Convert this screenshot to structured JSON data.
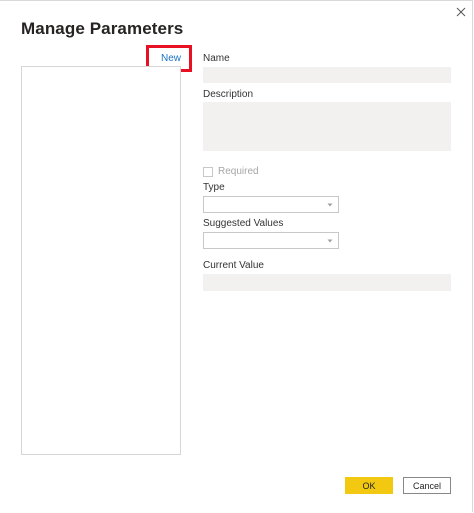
{
  "dialog": {
    "title": "Manage Parameters"
  },
  "list": {
    "new_label": "New"
  },
  "form": {
    "name_label": "Name",
    "name_value": "",
    "description_label": "Description",
    "description_value": "",
    "required_label": "Required",
    "required_checked": false,
    "type_label": "Type",
    "type_value": "",
    "suggested_values_label": "Suggested Values",
    "suggested_values_value": "",
    "current_value_label": "Current Value",
    "current_value_value": ""
  },
  "footer": {
    "ok_label": "OK",
    "cancel_label": "Cancel"
  },
  "colors": {
    "highlight_box": "#e81123",
    "link": "#1a73c6",
    "ok_button": "#f2c811",
    "field_bg": "#f2f1f0"
  },
  "icons": {
    "close": "close-icon",
    "dropdown": "chevron-down-icon"
  }
}
